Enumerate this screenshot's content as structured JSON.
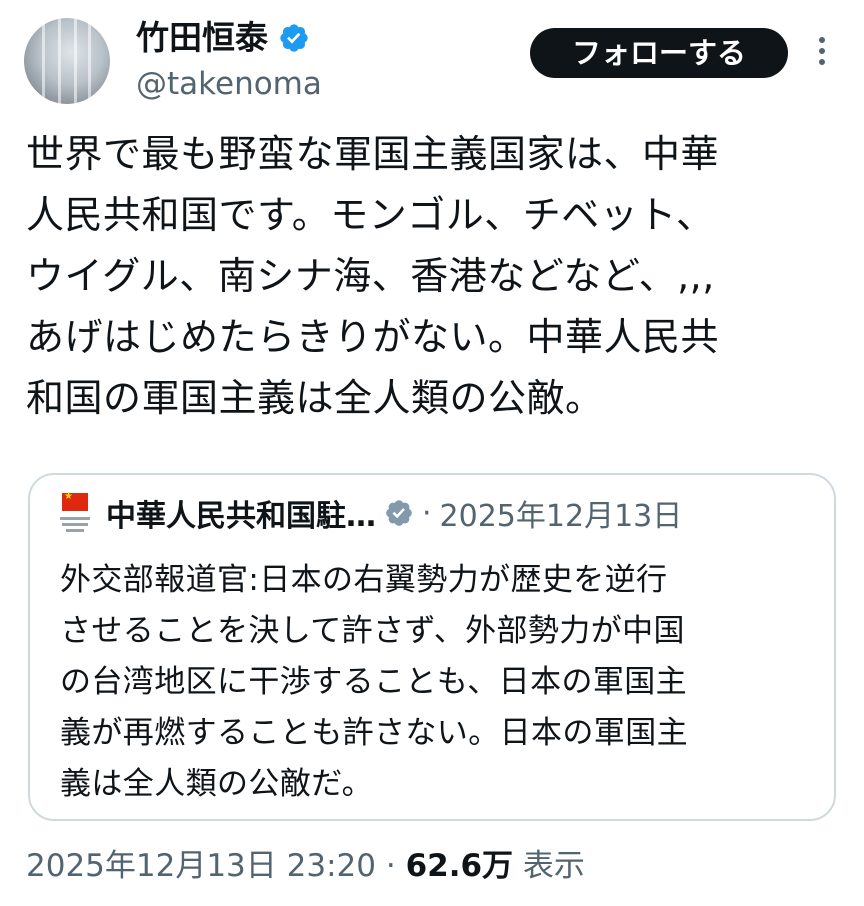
{
  "author": {
    "display_name": "竹田恒泰",
    "handle": "@takenoma",
    "verified_icon": "verified-badge-icon",
    "verified_color": "#1d9bf0"
  },
  "follow_button": {
    "label": "フォローする"
  },
  "more_button": {
    "icon": "more-vertical-icon"
  },
  "tweet": {
    "lines": [
      "世界で最も野蛮な軍国主義国家は、中華",
      "人民共和国です。モンゴル、チベット、",
      "ウイグル、南シナ海、香港などなど、,,,",
      "あげはじめたらきりがない。中華人民共",
      "和国の軍国主義は全人類の公敵。"
    ]
  },
  "quote": {
    "author_name": "中華人民共和国駐…",
    "separator": "·",
    "date": "2025年12月13日",
    "lines": [
      "外交部報道官:日本の右翼勢力が歴史を逆行",
      "させることを決して許さず、外部勢力が中国",
      "の台湾地区に干渉することも、日本の軍国主",
      "義が再燃することも許さない。日本の軍国主",
      "義は全人類の公敵だ。"
    ]
  },
  "meta": {
    "timestamp": "2025年12月13日 23:20",
    "separator": "·",
    "views_count": "62.6万",
    "views_label": "表示"
  },
  "colors": {
    "text": "#0f1419",
    "secondary": "#536471",
    "border": "#cfd9de",
    "follow_bg": "#0f1419"
  }
}
